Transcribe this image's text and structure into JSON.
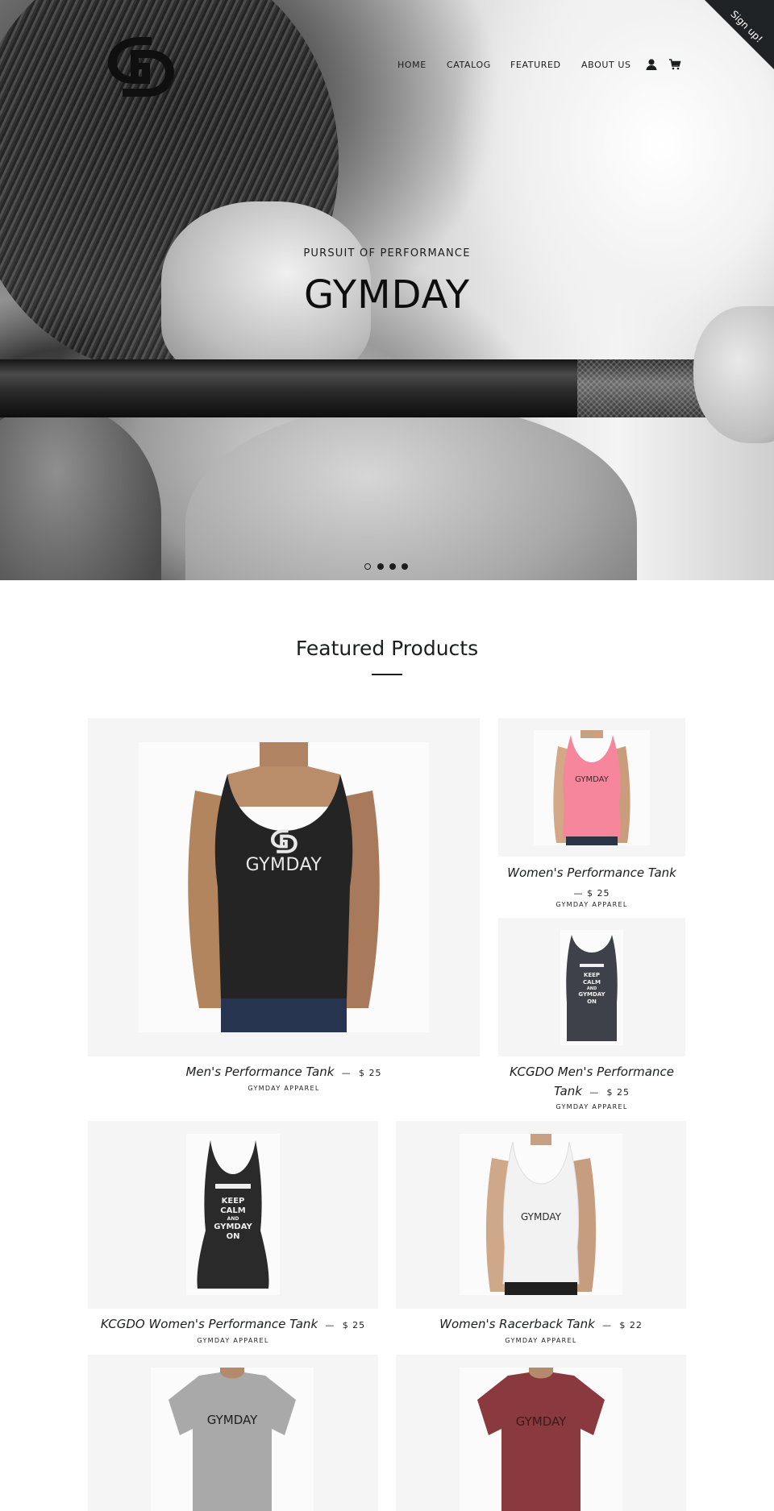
{
  "brand": {
    "signup_label": "Sign up!"
  },
  "nav": {
    "items": [
      "HOME",
      "CATALOG",
      "FEATURED",
      "ABOUT US"
    ]
  },
  "hero": {
    "subtitle": "PURSUIT OF PERFORMANCE",
    "title": "GYMDAY",
    "slides_total": 4,
    "active_slide": 1
  },
  "featured": {
    "title": "Featured Products",
    "products": [
      {
        "title": "Men's Performance Tank",
        "price": "$ 25",
        "vendor": "GYMDAY APPAREL",
        "image_print": "GYMDAY"
      },
      {
        "title": "Women's Performance Tank",
        "price": "$ 25",
        "vendor": "GYMDAY APPAREL",
        "image_print": "GYMDAY"
      },
      {
        "title": "KCGDO Men's Performance",
        "title_line2": "Tank",
        "price": "$ 25",
        "vendor": "GYMDAY APPAREL",
        "image_print": [
          "KEEP",
          "CALM",
          "AND",
          "GYMDAY",
          "ON"
        ]
      },
      {
        "title": "KCGDO Women's Performance Tank",
        "price": "$ 25",
        "vendor": "GYMDAY APPAREL",
        "image_print": [
          "KEEP",
          "CALM",
          "AND",
          "GYMDAY",
          "ON"
        ]
      },
      {
        "title": "Women's Racerback Tank",
        "price": "$ 22",
        "vendor": "GYMDAY APPAREL",
        "image_print": "GYMDAY"
      },
      {
        "image_print": "GYMDAY"
      },
      {
        "image_print": "GYMDAY"
      }
    ]
  },
  "colors": {
    "text": "#1c1d1d",
    "card_bg": "#f5f5f5",
    "signup_bg": "#1f2225",
    "pink_tank": "#f5869b",
    "maroon_tee": "#8a3a3e"
  }
}
